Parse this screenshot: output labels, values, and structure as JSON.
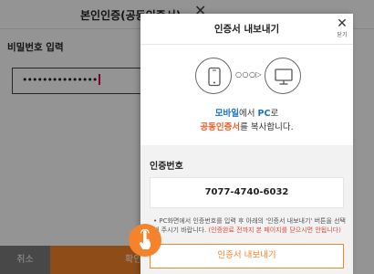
{
  "background_dialog": {
    "title": "본인인증(공동인증서)",
    "close_glyph": "✕",
    "password_label": "비밀번호 입력",
    "password_value": "•••••••••••••••",
    "cancel_label": "취소",
    "confirm_label": "확인"
  },
  "modal": {
    "title": "인증서 내보내기",
    "close_glyph": "✕",
    "close_label": "닫기",
    "arrow_text": "○○○▷",
    "desc_line1": {
      "part1": "모바일",
      "part2": "에서 ",
      "part3": "PC",
      "part4": "로"
    },
    "desc_line2": {
      "part1": "공동인증서",
      "part2": "를 복사합니다."
    },
    "cert_number_label": "인증번호",
    "cert_number": "7077-4740-6032",
    "notice_text": "• PC화면에서 인증번호를 입력 후 아래의 '인증서 내보내기' 버튼을 선택해 주시기 바랍니다. ",
    "notice_warning": "(인증완료 전까지 본 페이지를 닫으시면 안됩니다)",
    "export_button_label": "인증서 내보내기"
  },
  "colors": {
    "accent_orange": "#f4832b",
    "link_blue": "#1a73c9",
    "cancel_gray": "#7d7d7d"
  },
  "icons": {
    "mobile": "mobile-phone-icon",
    "pc": "monitor-icon",
    "pointer": "hand-pointer-icon"
  }
}
